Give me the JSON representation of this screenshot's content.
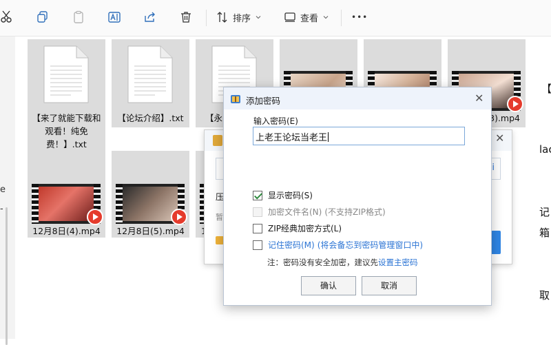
{
  "toolbar": {
    "sort_label": "排序",
    "view_label": "查看",
    "more_label": "•••",
    "icons": [
      "cut-icon",
      "copy-icon",
      "paste-icon",
      "rename-icon",
      "share-icon",
      "delete-icon",
      "sort-icon",
      "view-icon",
      "more-icon"
    ]
  },
  "files": [
    {
      "name": "【来了就能下载和观看！纯免费！】.txt",
      "type": "txt"
    },
    {
      "name": "【论坛介绍】.txt",
      "type": "txt"
    },
    {
      "name": "【永",
      "type": "txt"
    },
    {
      "name": "",
      "type": "mp4"
    },
    {
      "name": "",
      "type": "mp4"
    },
    {
      "name": "3).mp4",
      "type": "mp4"
    },
    {
      "name": "12月8日(4).mp4",
      "type": "mp4"
    },
    {
      "name": "12月8日(5).mp4",
      "type": "mp4"
    },
    {
      "name": "1",
      "type": "mp4"
    }
  ],
  "right_fragments": [
    "【",
    "lac",
    "记",
    "箱",
    "（",
    "取"
  ],
  "left_fragments": [
    "e",
    "-"
  ],
  "back_dialog": {
    "frag1": "压",
    "frag2": "暂",
    "input_frag": "i"
  },
  "dialog": {
    "title": "添加密码",
    "password_label": "输入密码(E)",
    "password_value": "上老王论坛当老王",
    "show_password": {
      "label": "显示密码(S)",
      "checked": true
    },
    "encrypt_filenames": {
      "label": "加密文件名(N)",
      "note": "(不支持ZIP格式)",
      "enabled": false
    },
    "zip_classic": {
      "label": "ZIP经典加密方式(L)",
      "checked": false
    },
    "remember": {
      "label": "记住密码(M)",
      "note": "(将会备忘到密码管理窗口中)",
      "checked": false
    },
    "hint": {
      "prefix": "注：密码没有安全加密，建议先",
      "link": "设置主密码"
    },
    "ok_label": "确认",
    "cancel_label": "取消"
  }
}
